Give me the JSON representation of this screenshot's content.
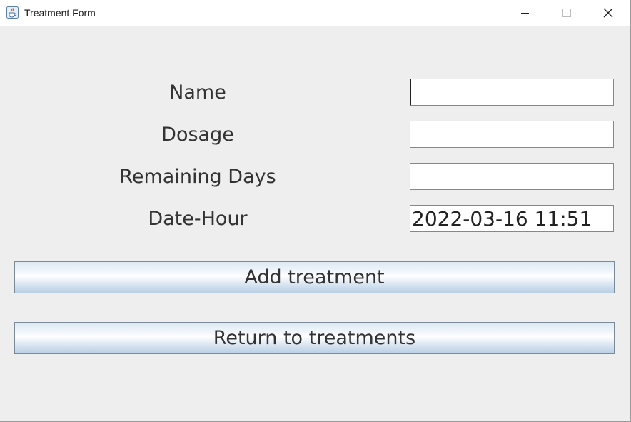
{
  "window": {
    "title": "Treatment Form",
    "icons": {
      "app": "java-cup-icon",
      "minimize": "minimize-icon",
      "maximize": "maximize-icon",
      "close": "close-icon"
    }
  },
  "form": {
    "fields": [
      {
        "label": "Name",
        "value": "",
        "placeholder": ""
      },
      {
        "label": "Dosage",
        "value": "",
        "placeholder": ""
      },
      {
        "label": "Remaining Days",
        "value": "",
        "placeholder": ""
      },
      {
        "label": "Date-Hour",
        "value": "2022-03-16 11:51",
        "placeholder": ""
      }
    ]
  },
  "buttons": {
    "add_label": "Add treatment",
    "return_label": "Return to treatments"
  },
  "colors": {
    "background": "#eeeeee",
    "title_bar": "#ffffff",
    "text": "#333333",
    "button_gradient_top": "#dde8f3",
    "button_gradient_bottom": "#b8cfe5",
    "input_border": "#7a8a99"
  }
}
